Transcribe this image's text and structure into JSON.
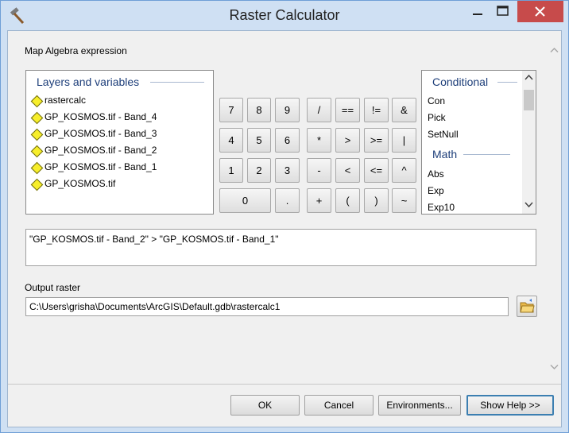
{
  "window": {
    "title": "Raster Calculator"
  },
  "expression_label": "Map Algebra expression",
  "layers": {
    "header": "Layers and variables",
    "items": [
      "rastercalc",
      "GP_KOSMOS.tif - Band_4",
      "GP_KOSMOS.tif - Band_3",
      "GP_KOSMOS.tif - Band_2",
      "GP_KOSMOS.tif - Band_1",
      "GP_KOSMOS.tif"
    ]
  },
  "keypad": {
    "k7": "7",
    "k8": "8",
    "k9": "9",
    "div": "/",
    "eq": "==",
    "neq": "!=",
    "and": "&",
    "k4": "4",
    "k5": "5",
    "k6": "6",
    "mul": "*",
    "gt": ">",
    "gte": ">=",
    "or": "|",
    "k1": "1",
    "k2": "2",
    "k3": "3",
    "sub": "-",
    "lt": "<",
    "lte": "<=",
    "xor": "^",
    "k0": "0",
    "dot": ".",
    "add": "+",
    "lparen": "(",
    "rparen": ")",
    "not": "~"
  },
  "functions": {
    "conditional_header": "Conditional",
    "conditional_items": [
      "Con",
      "Pick",
      "SetNull"
    ],
    "math_header": "Math",
    "math_items": [
      "Abs",
      "Exp",
      "Exp10"
    ]
  },
  "expression": "\"GP_KOSMOS.tif - Band_2\" > \"GP_KOSMOS.tif - Band_1\"",
  "output": {
    "label": "Output raster",
    "value": "C:\\Users\\grisha\\Documents\\ArcGIS\\Default.gdb\\rastercalc1"
  },
  "buttons": {
    "ok": "OK",
    "cancel": "Cancel",
    "environments": "Environments...",
    "show_help": "Show Help >>"
  }
}
